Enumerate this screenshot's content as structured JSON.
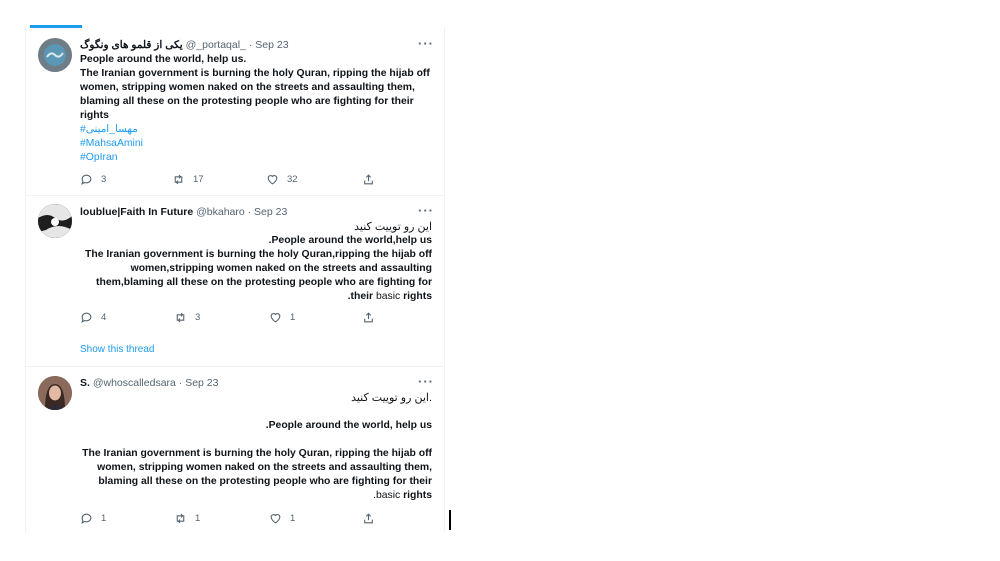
{
  "tweets": [
    {
      "name": "یکی از قلمو های ونگوگ",
      "handle": "@_portaqal_",
      "date": "· Sep 23",
      "lines": [
        "People around the world, help us.",
        "The Iranian government is burning the holy Quran, ripping the hijab off",
        "women, stripping women naked on the streets and assaulting them,",
        "blaming all these on the protesting people who are fighting for their",
        "rights"
      ],
      "hashtags": [
        "#مهسا_امینی",
        "#MahsaAmini",
        "#OpIran"
      ],
      "replies": "3",
      "retweets": "17",
      "likes": "32"
    },
    {
      "name": "loublue|Faith In Future",
      "handle": "@bkaharo",
      "date": "· Sep 23",
      "lines": [
        "این رو توییت کنید",
        ".People around the world,help us",
        "The Iranian government is burning the holy Quran,ripping the hijab off",
        "women,stripping women naked on the streets and assaulting",
        "them,blaming all these on the protesting people who are fighting for",
        ".their",
        "basic",
        "rights"
      ],
      "replies": "4",
      "retweets": "3",
      "likes": "1",
      "show_thread": "Show this thread"
    },
    {
      "name": "S.",
      "handle": "@whoscalledsara",
      "date": "· Sep 23",
      "lines": [
        "این رو توییت کنید.",
        ".People around the world, help us",
        "The Iranian government is burning the holy Quran, ripping the hijab off",
        "women, stripping women naked on the streets and assaulting them,",
        "blaming all these on the protesting people who are fighting for their",
        ".basic",
        "rights"
      ],
      "replies": "1",
      "retweets": "1",
      "likes": "1"
    }
  ],
  "more_label": "···",
  "icons": {
    "reply": "reply-icon",
    "retweet": "retweet-icon",
    "like": "heart-icon",
    "share": "share-icon"
  }
}
